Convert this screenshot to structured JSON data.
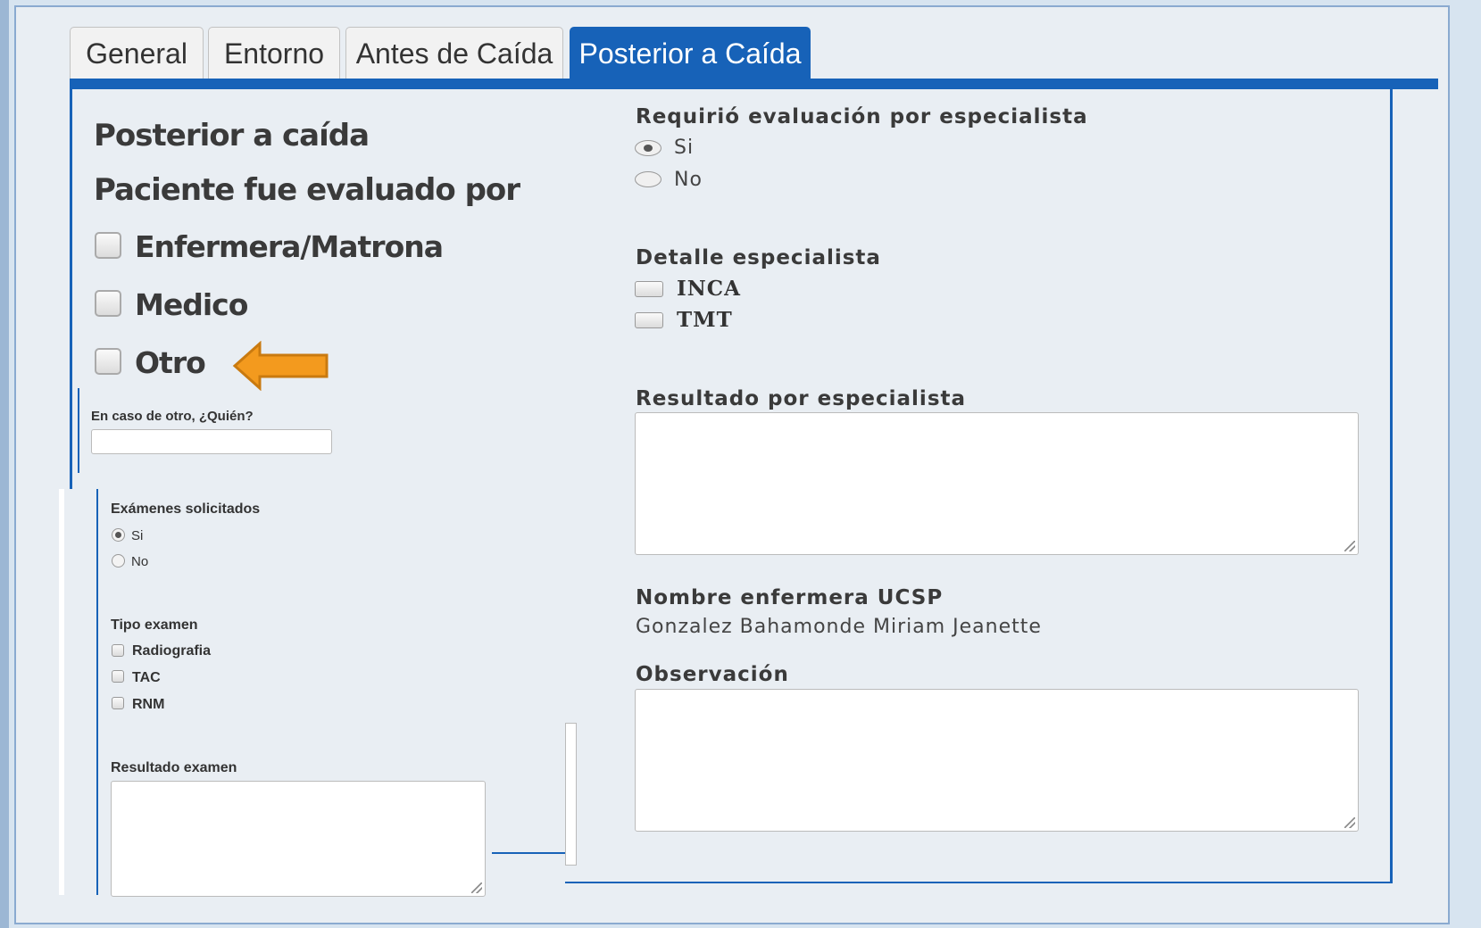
{
  "tabs": [
    "General",
    "Entorno",
    "Antes de Caída",
    "Posterior a Caída"
  ],
  "left": {
    "title": "Posterior a caída",
    "subtitle": "Paciente fue evaluado por",
    "evaluators": [
      "Enfermera/Matrona",
      "Medico",
      "Otro"
    ],
    "other_label": "En caso de otro, ¿Quién?",
    "other_value": "",
    "exams_label": "Exámenes solicitados",
    "exams_options": [
      "Si",
      "No"
    ],
    "exams_selected": "Si",
    "exam_type_label": "Tipo examen",
    "exam_types": [
      "Radiografia",
      "TAC",
      "RNM"
    ],
    "exam_result_label": "Resultado examen",
    "exam_result_value": ""
  },
  "right": {
    "specialist_q": "Requirió evaluación por especialista",
    "specialist_options": [
      "Si",
      "No"
    ],
    "specialist_selected": "Si",
    "detail_label": "Detalle especialista",
    "detail_options": [
      "INCA",
      "TMT"
    ],
    "result_label": "Resultado por especialista",
    "result_value": "",
    "nurse_label": "Nombre enfermera UCSP",
    "nurse_name": "Gonzalez Bahamonde Miriam Jeanette",
    "obs_label": "Observación",
    "obs_value": ""
  },
  "colors": {
    "tab_active": "#1762b8",
    "arrow": "#f39a1e",
    "panel_bg": "#e9eef3"
  },
  "annotation": {
    "icon": "arrow-left-icon",
    "target": "Otro"
  }
}
